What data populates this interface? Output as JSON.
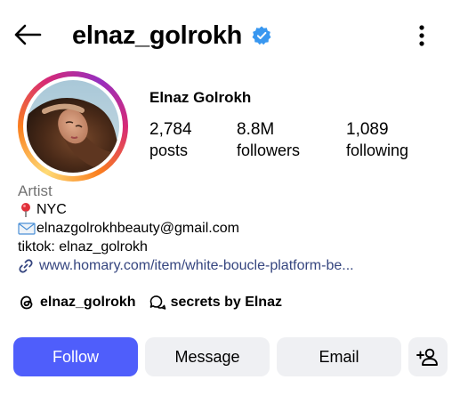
{
  "header": {
    "username": "elnaz_golrokh",
    "back_icon": "back-arrow-icon",
    "verified_icon": "verified-badge-icon",
    "more_icon": "more-vertical-icon"
  },
  "profile": {
    "display_name": "Elnaz Golrokh",
    "avatar_icon": "profile-photo"
  },
  "stats": [
    {
      "value": "2,784",
      "label": "posts"
    },
    {
      "value": "8.8M",
      "label": "followers"
    },
    {
      "value": "1,089",
      "label": "following"
    }
  ],
  "bio": {
    "category": "Artist",
    "location": "NYC",
    "email": "elnazgolrokhbeauty@gmail.com",
    "tiktok": "tiktok: elnaz_golrokh",
    "link": "www.homary.com/item/white-boucle-platform-be..."
  },
  "threads": {
    "handle": "elnaz_golrokh",
    "secrets": "secrets by Elnaz"
  },
  "actions": {
    "follow": "Follow",
    "message": "Message",
    "email": "Email"
  },
  "colors": {
    "follow_bg": "#4f5efb",
    "button_bg": "#eff0f3",
    "verified": "#3897f0",
    "link": "#35457f",
    "category": "#737373"
  }
}
